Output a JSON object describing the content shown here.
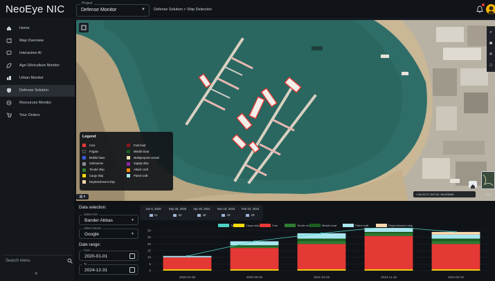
{
  "topbar": {
    "app_title": "NeoEye NIC",
    "project_label": "Project",
    "project_value": "Defense Monitor",
    "breadcrumb": "Defense Solution > Ship Detection",
    "icons": {
      "notification": "bell-icon",
      "avatar": "user-avatar"
    },
    "notification_dot_color": "#e53935"
  },
  "sidebar": {
    "items": [
      {
        "label": "Home",
        "icon": "home-icon"
      },
      {
        "label": "Map Overview",
        "icon": "map-icon"
      },
      {
        "label": "Interactive AI",
        "icon": "chat-icon"
      },
      {
        "label": "Agri-Silviculture Monitor",
        "icon": "leaf-icon"
      },
      {
        "label": "Urban Monitor",
        "icon": "city-icon"
      },
      {
        "label": "Defense Solution",
        "icon": "shield-icon",
        "active": true
      },
      {
        "label": "Resources Monitor",
        "icon": "resource-icon"
      },
      {
        "label": "Your Orders",
        "icon": "cart-icon"
      }
    ],
    "search_label": "Search menu",
    "collapse_label": "«"
  },
  "map": {
    "legend_title": "Legend",
    "legend_items": [
      {
        "label": "Cow",
        "color": "#e53935"
      },
      {
        "label": "Frigate",
        "color": "#1e1e1e"
      },
      {
        "label": "Mobile base",
        "color": "#3b5bdb"
      },
      {
        "label": "Submarine",
        "color": "#868e96"
      },
      {
        "label": "Tender ship",
        "color": "#2e7d32"
      },
      {
        "label": "Cargo ship",
        "color": "#f5d90a"
      },
      {
        "label": "Replenishment ship",
        "color": "#f8d8b0"
      },
      {
        "label": "Fast boat",
        "color": "#8b1a1a"
      },
      {
        "label": "Missile boat",
        "color": "#1b5e20"
      },
      {
        "label": "Multipurpose vessel",
        "color": "#f1e4b8"
      },
      {
        "label": "Supply ship",
        "color": "#8e24aa"
      },
      {
        "label": "Attack craft",
        "color": "#fb8c00"
      },
      {
        "label": "Patrol craft",
        "color": "#a8e6f0"
      }
    ],
    "coordinates": "≈ 56.23   27.151742, 56.925495",
    "basemap_label": "Sat.",
    "tools": [
      "search-icon",
      "camera-icon",
      "close-icon",
      "square-icon"
    ]
  },
  "selection": {
    "title": "Data selection:",
    "aoi_label": "Select AOI",
    "aoi_value": "Bander Abbas",
    "source_label": "Select source",
    "source_value": "Google",
    "date_range_title": "Date range:",
    "from_label": "From",
    "from_value": "2020-01-01",
    "to_label": "To",
    "to_value": "2024-12-31"
  },
  "date_tabs": [
    {
      "date": "Jan 6, 2020",
      "count": "11"
    },
    {
      "date": "Sep 25, 2020",
      "count": "22"
    },
    {
      "date": "Apr 25, 2021",
      "count": "28"
    },
    {
      "date": "Nov 18, 2023",
      "count": "33"
    },
    {
      "date": "Feb 22, 2024",
      "count": "29"
    }
  ],
  "chart_data": {
    "type": "bar",
    "stacked": true,
    "categories": [
      "2020-01-06",
      "2020-09-25",
      "2021-04-25",
      "2023-11-18",
      "2024-02-22"
    ],
    "ylim": [
      0,
      30
    ],
    "yticks": [
      0,
      5,
      10,
      15,
      20,
      25,
      30
    ],
    "series": [
      {
        "name": "Cargo ship",
        "color": "#f5d90a",
        "values": [
          1,
          1,
          1,
          1,
          1
        ]
      },
      {
        "name": "Cow",
        "color": "#e53935",
        "values": [
          9,
          16,
          19,
          25,
          19
        ]
      },
      {
        "name": "Tender ship",
        "color": "#2e7d32",
        "values": [
          0,
          1,
          2,
          2,
          2
        ]
      },
      {
        "name": "Missile boat",
        "color": "#1b5e20",
        "values": [
          0,
          1,
          2,
          1,
          2
        ]
      },
      {
        "name": "Patrol craft",
        "color": "#a8e6f0",
        "values": [
          1,
          3,
          4,
          3,
          3
        ]
      },
      {
        "name": "Replenishment ship",
        "color": "#f8d8b0",
        "values": [
          0,
          0,
          0,
          1,
          2
        ]
      }
    ],
    "total_line": {
      "name": "Total",
      "color": "#4fd1c5",
      "values": [
        11,
        22,
        28,
        33,
        29
      ]
    },
    "legend": [
      {
        "label": "Total",
        "color": "#4fd1c5"
      },
      {
        "label": "Cargo ship",
        "color": "#f5d90a"
      },
      {
        "label": "Cow",
        "color": "#e53935"
      },
      {
        "label": "Tender ship",
        "color": "#2e7d32"
      },
      {
        "label": "Missile boat",
        "color": "#1b5e20"
      },
      {
        "label": "Patrol craft",
        "color": "#a8e6f0"
      },
      {
        "label": "Replenishment ship",
        "color": "#f8d8b0"
      }
    ],
    "legend_placement": "top"
  }
}
